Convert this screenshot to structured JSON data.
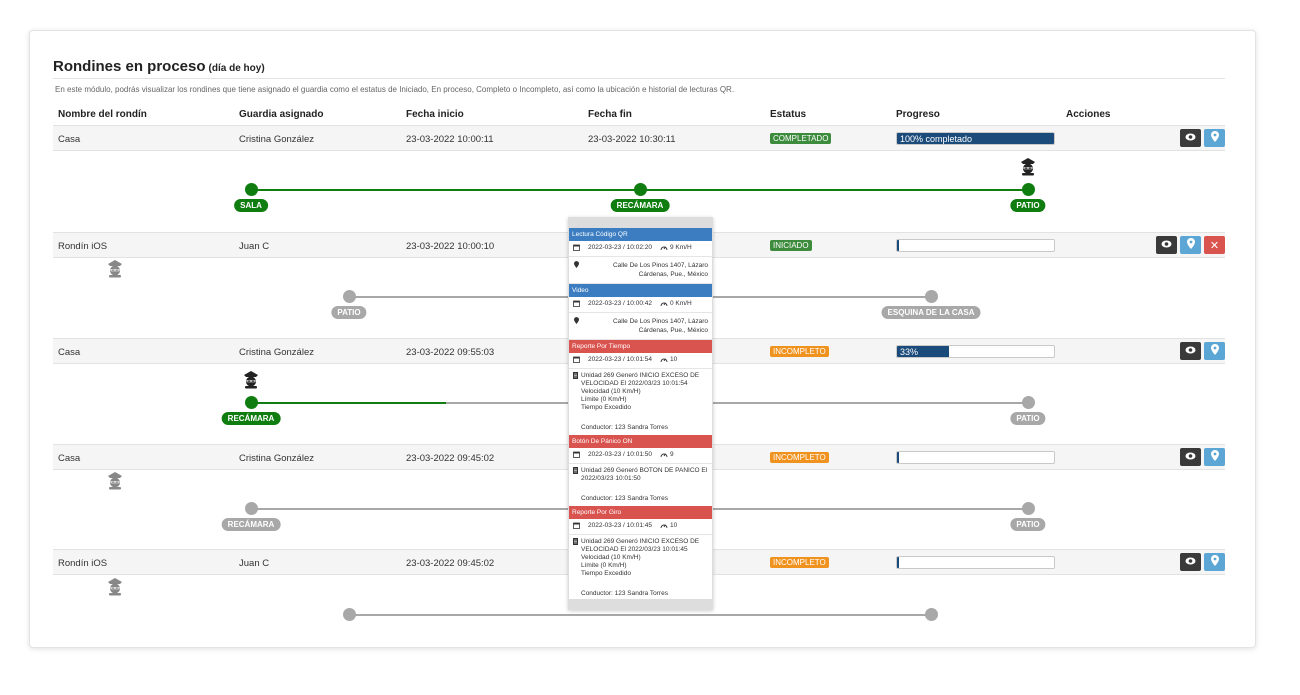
{
  "page": {
    "title": "Rondines en proceso",
    "title_small": "(día de hoy)",
    "description": "En este módulo, podrás visualizar los rondines que tiene asignado el guardia como el estatus de Iniciado, En proceso, Completo o Incompleto, así como la ubicación e historial de lecturas QR."
  },
  "table": {
    "headers": [
      "Nombre del rondín",
      "Guardia asignado",
      "Fecha inicio",
      "Fecha fin",
      "Estatus",
      "Progreso",
      "Acciones"
    ],
    "rows": [
      {
        "name": "Casa",
        "guard": "Cristina González",
        "start": "23-03-2022 10:00:11",
        "end": "23-03-2022 10:30:11",
        "status": "COMPLETADO",
        "progress": 1.0,
        "progress_text": "100% completado",
        "points": [
          "SALA",
          "RECÁMARA",
          "PATIO"
        ]
      },
      {
        "name": "Rondín iOS",
        "guard": "Juan C",
        "start": "23-03-2022 10:00:10",
        "end": "",
        "status": "INICIADO",
        "progress": 0.0,
        "progress_text": "",
        "points": [
          "PATIO",
          "ESQUINA DE LA CASA"
        ]
      },
      {
        "name": "Casa",
        "guard": "Cristina González",
        "start": "23-03-2022 09:55:03",
        "end": "",
        "status": "INCOMPLETO",
        "progress": 0.33,
        "progress_text": "33%",
        "points": [
          "RECÁMARA",
          "PATIO"
        ]
      },
      {
        "name": "Casa",
        "guard": "Cristina González",
        "start": "23-03-2022 09:45:02",
        "end": "",
        "status": "INCOMPLETO",
        "progress": 0.0,
        "progress_text": "",
        "points": [
          "RECÁMARA",
          "PATIO"
        ]
      },
      {
        "name": "Rondín iOS",
        "guard": "Juan C",
        "start": "23-03-2022 09:45:02",
        "end": "",
        "status": "INCOMPLETO",
        "progress": 0.0,
        "progress_text": "",
        "points": []
      }
    ]
  },
  "colors": {
    "completado": "#3d8b3d",
    "iniciado": "#3d8b3d",
    "incompleto": "#f0921e",
    "done": "#0f7d0f",
    "pending": "#a8a8a8",
    "progress": "#1a4b7a"
  },
  "popup": {
    "sections": [
      {
        "title": "Lectura Código QR",
        "color": "blue",
        "datetime": "2022-03-23 / 10:02:20",
        "speed": "9 Km/H",
        "address": "Calle De Los Pinos 1407, Lázaro Cárdenas, Pue., México"
      },
      {
        "title": "Video",
        "color": "blue",
        "datetime": "2022-03-23 / 10:00:42",
        "speed": "0 Km/H",
        "address": "Calle De Los Pinos 1407, Lázaro Cárdenas, Pue., México"
      },
      {
        "title": "Reporte Por Tiempo",
        "color": "red",
        "datetime": "2022-03-23 / 10:01:54",
        "speed": "10",
        "detail": "Unidad 269 Generó INICIO EXCESO DE VELOCIDAD El 2022/03/23 10:01:54\nVelocidad (10 Km/H)\nLímite (0 Km/H)\nTiempo Excedido",
        "conductor": "Conductor: 123 Sandra Torres"
      },
      {
        "title": "Botón De Pánico ON",
        "color": "red",
        "datetime": "2022-03-23 / 10:01:50",
        "speed": "9",
        "detail": "Unidad 269 Generó BOTON DE PANICO El 2022/03/23 10:01:50",
        "conductor": "Conductor: 123 Sandra Torres"
      },
      {
        "title": "Reporte Por Giro",
        "color": "red",
        "datetime": "2022-03-23 / 10:01:45",
        "speed": "10",
        "detail": "Unidad 269 Generó INICIO EXCESO DE VELOCIDAD El 2022/03/23 10:01:45\nVelocidad (10 Km/H)\nLímite (0 Km/H)\nTiempo Excedido",
        "conductor": "Conductor: 123 Sandra Torres"
      }
    ]
  },
  "icons": {
    "view": "eye-icon",
    "location": "map-marker-icon",
    "delete": "close-icon",
    "guard": "guard-icon",
    "calendar": "calendar-icon",
    "speed": "speedometer-icon"
  }
}
